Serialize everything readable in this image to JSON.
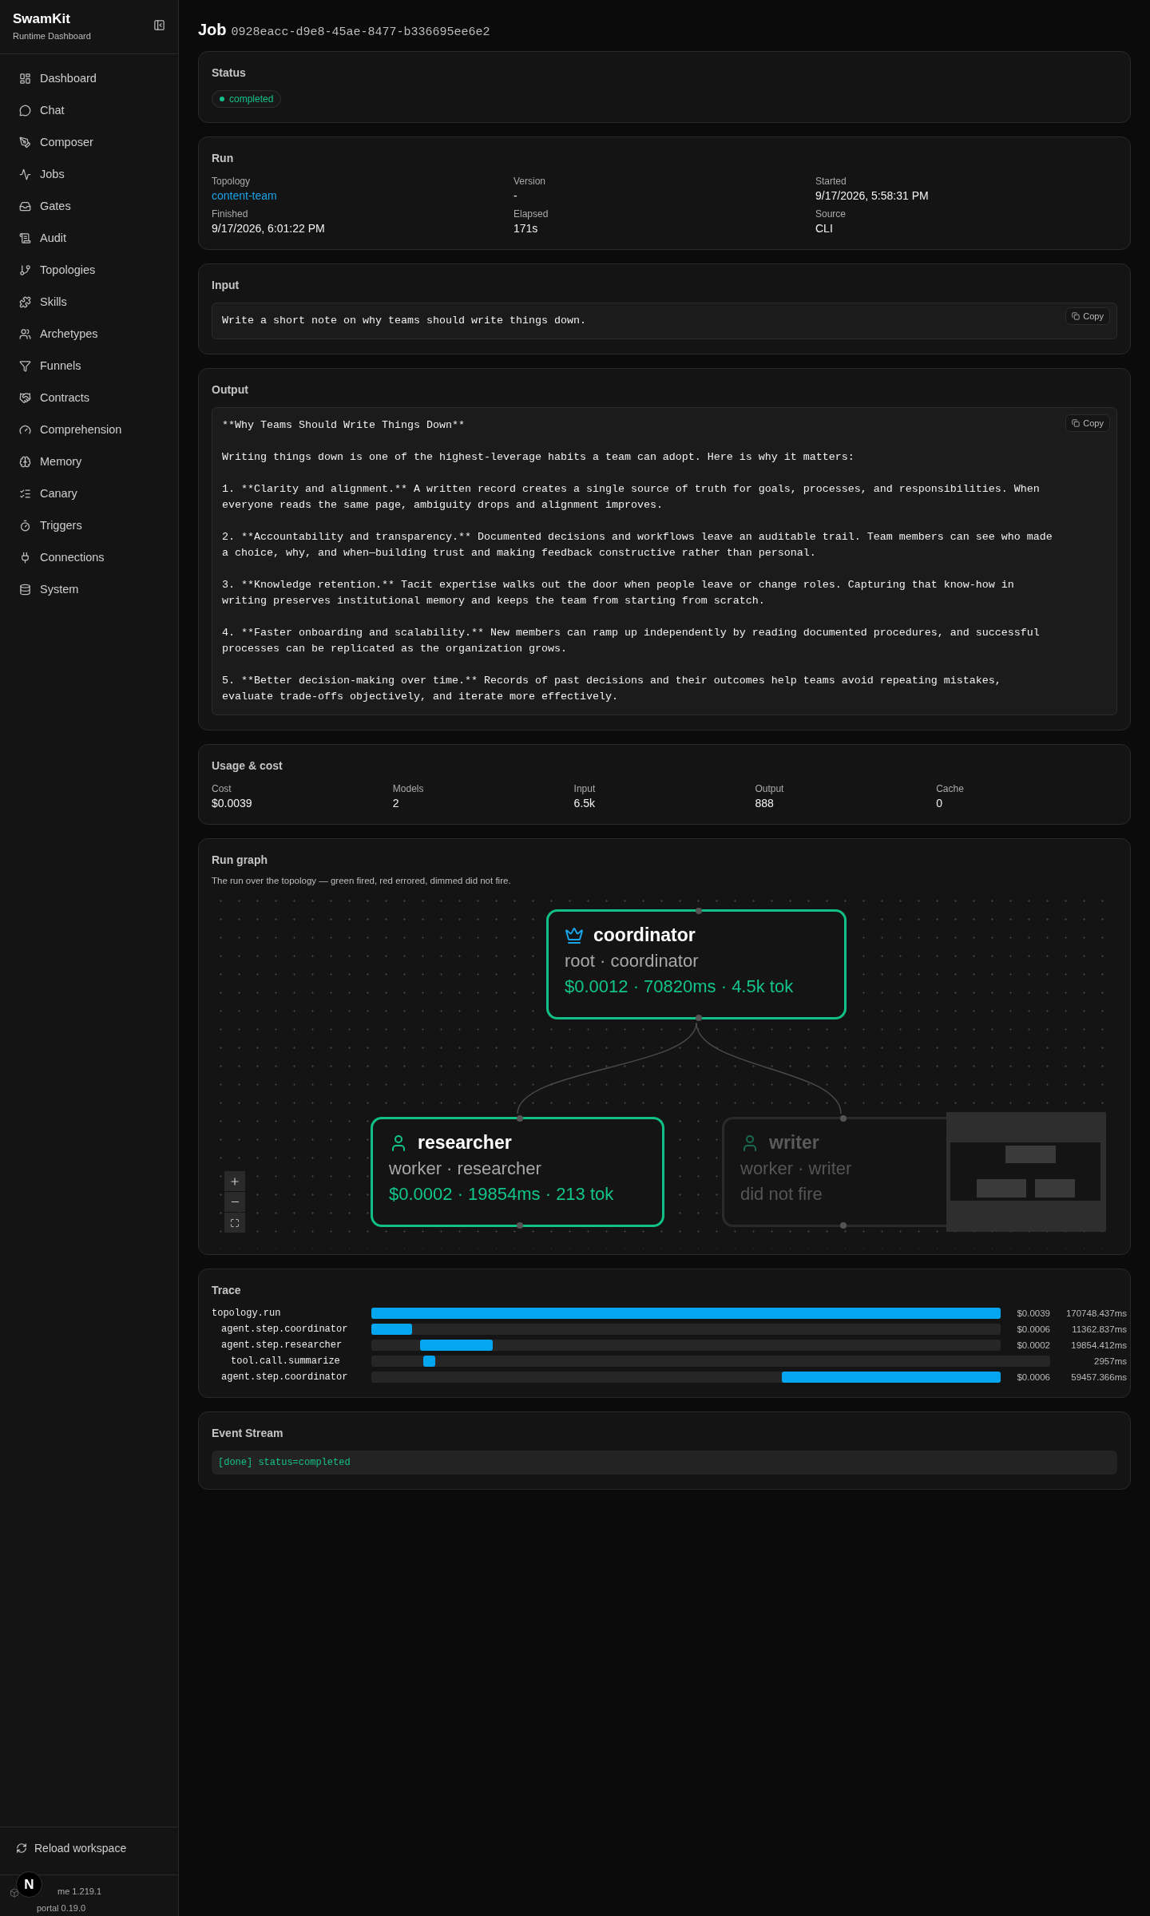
{
  "sidebar": {
    "brand": "SwamKit",
    "subtitle": "Runtime Dashboard",
    "items": [
      {
        "label": "Dashboard",
        "selected": false
      },
      {
        "label": "Chat",
        "selected": false
      },
      {
        "label": "Composer",
        "selected": false
      },
      {
        "label": "Jobs",
        "selected": false
      },
      {
        "label": "Gates",
        "selected": false
      },
      {
        "label": "Audit",
        "selected": false
      },
      {
        "label": "Topologies",
        "selected": false
      },
      {
        "label": "Skills",
        "selected": false
      },
      {
        "label": "Archetypes",
        "selected": false
      },
      {
        "label": "Funnels",
        "selected": false
      },
      {
        "label": "Contracts",
        "selected": false
      },
      {
        "label": "Comprehension",
        "selected": false
      },
      {
        "label": "Memory",
        "selected": false
      },
      {
        "label": "Canary",
        "selected": false
      },
      {
        "label": "Triggers",
        "selected": false
      },
      {
        "label": "Connections",
        "selected": false
      },
      {
        "label": "System",
        "selected": false
      }
    ],
    "reload": "Reload workspace",
    "versions": [
      "me 1.219.1",
      "portal 0.19.0"
    ],
    "dev_badge": "N"
  },
  "header": {
    "title": "Job",
    "job_id": "0928eacc-d9e8-45ae-8477-b336695ee6e2"
  },
  "status": {
    "title": "Status",
    "value": "completed"
  },
  "run": {
    "title": "Run",
    "fields": [
      {
        "label": "Topology",
        "value": "content-team",
        "kind": "link"
      },
      {
        "label": "Version",
        "value": "-",
        "kind": "text"
      },
      {
        "label": "Started",
        "value": "9/17/2026, 5:58:31 PM",
        "kind": "text"
      },
      {
        "label": "Finished",
        "value": "9/17/2026, 6:01:22 PM",
        "kind": "text"
      },
      {
        "label": "Elapsed",
        "value": "171s",
        "kind": "text"
      },
      {
        "label": "Source",
        "value": "CLI",
        "kind": "text"
      }
    ]
  },
  "input": {
    "title": "Input",
    "text": "Write a short note on why teams should write things down.",
    "copy": "Copy"
  },
  "output": {
    "title": "Output",
    "text": "**Why Teams Should Write Things Down**\n\nWriting things down is one of the highest-leverage habits a team can adopt. Here is why it matters:\n\n1. **Clarity and alignment.** A written record creates a single source of truth for goals, processes, and responsibilities. When everyone reads the same page, ambiguity drops and alignment improves.\n\n2. **Accountability and transparency.** Documented decisions and workflows leave an auditable trail. Team members can see who made a choice, why, and when—building trust and making feedback constructive rather than personal.\n\n3. **Knowledge retention.** Tacit expertise walks out the door when people leave or change roles. Capturing that know-how in writing preserves institutional memory and keeps the team from starting from scratch.\n\n4. **Faster onboarding and scalability.** New members can ramp up independently by reading documented procedures, and successful processes can be replicated as the organization grows.\n\n5. **Better decision-making over time.** Records of past decisions and their outcomes help teams avoid repeating mistakes, evaluate trade-offs objectively, and iterate more effectively.",
    "copy": "Copy"
  },
  "usage": {
    "title": "Usage & cost",
    "fields": [
      {
        "label": "Cost",
        "value": "$0.0039"
      },
      {
        "label": "Models",
        "value": "2"
      },
      {
        "label": "Input",
        "value": "6.5k"
      },
      {
        "label": "Output",
        "value": "888"
      },
      {
        "label": "Cache",
        "value": "0"
      }
    ]
  },
  "run_graph": {
    "title": "Run graph",
    "description": "The run over the topology — green fired, red errored, dimmed did not fire.",
    "nodes": [
      {
        "name": "coordinator",
        "role": "root · coordinator",
        "stats": "$0.0012 · 70820ms · 4.5k tok",
        "kind": "root",
        "fired": true
      },
      {
        "name": "researcher",
        "role": "worker · researcher",
        "stats": "$0.0002 · 19854ms · 213 tok",
        "kind": "worker",
        "fired": true
      },
      {
        "name": "writer",
        "role": "worker · writer",
        "stats": "did not fire",
        "kind": "worker",
        "fired": false
      }
    ]
  },
  "trace": {
    "title": "Trace",
    "spans": [
      {
        "name": "topology.run",
        "cost": "$0.0039",
        "duration": "170748.437ms",
        "children": [
          {
            "name": "agent.step.coordinator",
            "cost": "$0.0006",
            "duration": "11362.837ms"
          },
          {
            "name": "agent.step.researcher",
            "cost": "$0.0002",
            "duration": "19854.412ms",
            "children": [
              {
                "name": "tool.call.summarize",
                "duration": "2957ms"
              }
            ]
          },
          {
            "name": "agent.step.coordinator",
            "cost": "$0.0006",
            "duration": "59457.366ms"
          }
        ]
      }
    ]
  },
  "event_stream": {
    "title": "Event Stream",
    "events": [
      "[done] status=completed"
    ]
  }
}
